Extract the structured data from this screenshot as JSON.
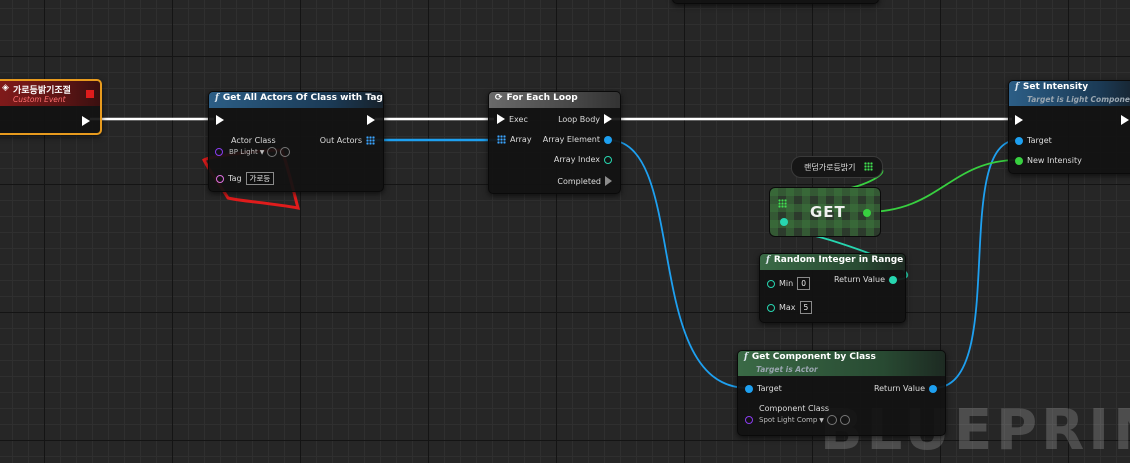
{
  "watermark": "BLUEPRINT",
  "nodes": {
    "custom_event": {
      "title": "가로등밝기조절",
      "subtitle": "Custom Event"
    },
    "get_all_actors": {
      "title": "Get All Actors Of Class with Tag",
      "actor_class_label": "Actor Class",
      "actor_class_value": "BP Light",
      "out_actors_label": "Out Actors",
      "tag_label": "Tag",
      "tag_value": "가로등"
    },
    "for_each": {
      "title": "For Each Loop",
      "exec_label": "Exec",
      "array_label": "Array",
      "loop_body_label": "Loop Body",
      "array_element_label": "Array Element",
      "array_index_label": "Array Index",
      "completed_label": "Completed"
    },
    "set_intensity": {
      "title": "Set Intensity",
      "subtitle": "Target is Light Component",
      "target_label": "Target",
      "new_intensity_label": "New Intensity"
    },
    "variable": {
      "label": "랜덤가로등밝기"
    },
    "get": {
      "label": "GET"
    },
    "random_int": {
      "title": "Random Integer in Range",
      "min_label": "Min",
      "min_value": "0",
      "max_label": "Max",
      "max_value": "5",
      "return_label": "Return Value"
    },
    "get_component": {
      "title": "Get Component by Class",
      "subtitle": "Target is Actor",
      "target_label": "Target",
      "return_label": "Return Value",
      "component_class_label": "Component Class",
      "component_class_value": "Spot Light Comp"
    }
  },
  "colors": {
    "exec_wire": "#ffffff",
    "object_wire": "#1ea0f0",
    "float_wire": "#38d040",
    "int_wire": "#27d6b0",
    "annotation": "#e01c1c"
  }
}
